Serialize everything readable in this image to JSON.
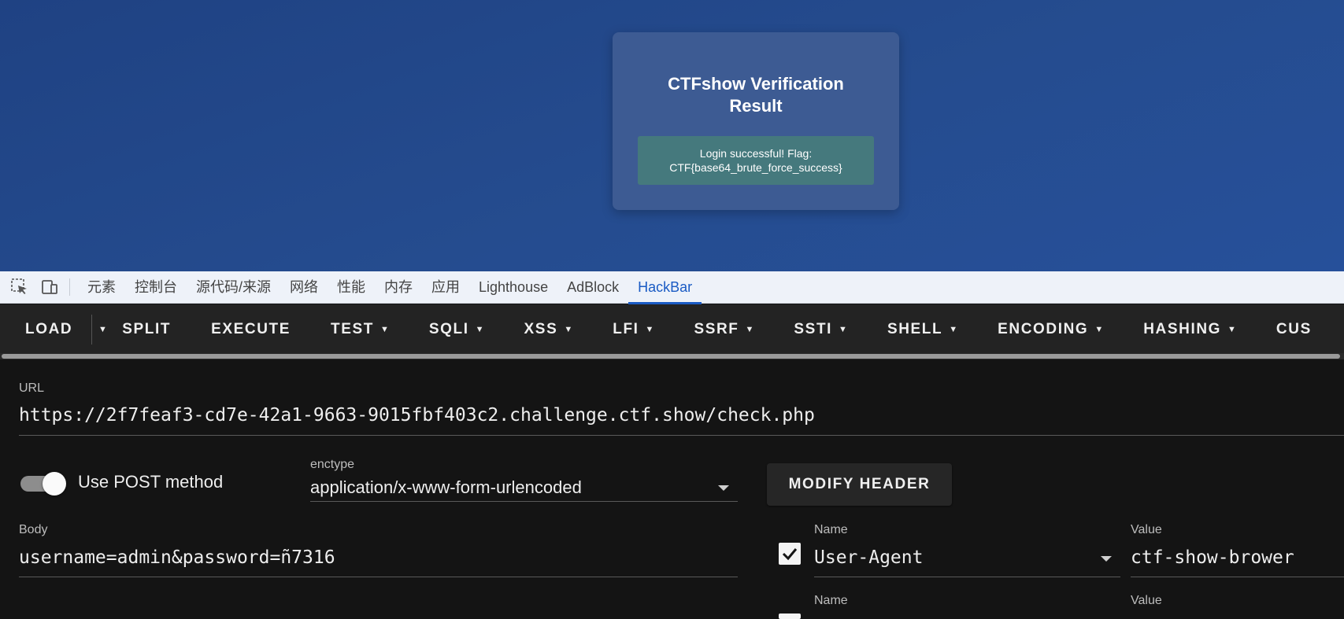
{
  "card": {
    "title": "CTFshow Verification Result",
    "result_line1": "Login successful! Flag:",
    "result_line2": "CTF{base64_brute_force_success}"
  },
  "devtools": {
    "tabs": [
      "元素",
      "控制台",
      "源代码/来源",
      "网络",
      "性能",
      "内存",
      "应用",
      "Lighthouse",
      "AdBlock",
      "HackBar"
    ],
    "active_tab": "HackBar",
    "icons": [
      "inspect-element-icon",
      "device-toolbar-icon"
    ]
  },
  "hackbar": {
    "toolbar": {
      "load": "LOAD",
      "split": "SPLIT",
      "execute": "EXECUTE",
      "menus": [
        "TEST",
        "SQLI",
        "XSS",
        "LFI",
        "SSRF",
        "SSTI",
        "SHELL",
        "ENCODING",
        "HASHING",
        "CUS"
      ]
    },
    "url_label": "URL",
    "url_value": "https://2f7feaf3-cd7e-42a1-9663-9015fbf403c2.challenge.ctf.show/check.php",
    "post_toggle_label": "Use POST method",
    "post_enabled": true,
    "enctype_label": "enctype",
    "enctype_value": "application/x-www-form-urlencoded",
    "modify_header_label": "MODIFY HEADER",
    "body_label": "Body",
    "body_value": "username=admin&password=ñ7316",
    "headers": [
      {
        "name_label": "Name",
        "name": "User-Agent",
        "value_label": "Value",
        "value": "ctf-show-brower",
        "checked": true
      },
      {
        "name_label": "Name",
        "name": "",
        "value_label": "Value",
        "value": "",
        "checked": true
      }
    ]
  }
}
